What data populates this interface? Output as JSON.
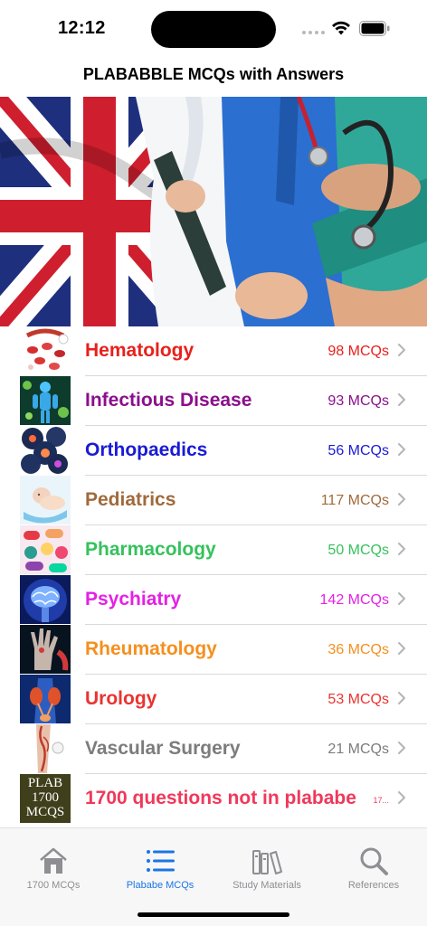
{
  "status_bar": {
    "time": "12:12"
  },
  "nav": {
    "title": "PLABABBLE MCQs with Answers"
  },
  "hero": {
    "icon": "union-jack-doctors-banner"
  },
  "categories": [
    {
      "name": "Hematology",
      "count": "98 MCQs",
      "color": "#e8201c",
      "icon": "blood-cells-thumbnail"
    },
    {
      "name": "Infectious Disease",
      "count": "93 MCQs",
      "color": "#8a0f8c",
      "icon": "virus-body-thumbnail"
    },
    {
      "name": "Orthopaedics",
      "count": "56 MCQs",
      "color": "#1a1ad6",
      "icon": "joints-thumbnail"
    },
    {
      "name": "Pediatrics",
      "count": "117 MCQs",
      "color": "#a06a3c",
      "icon": "baby-thumbnail"
    },
    {
      "name": "Pharmacology",
      "count": "50 MCQs",
      "color": "#35c25c",
      "icon": "pills-thumbnail"
    },
    {
      "name": "Psychiatry",
      "count": "142 MCQs",
      "color": "#e520e5",
      "icon": "brain-thumbnail"
    },
    {
      "name": "Rheumatology",
      "count": "36 MCQs",
      "color": "#f58f1e",
      "icon": "hand-xray-thumbnail"
    },
    {
      "name": "Urology",
      "count": "53 MCQs",
      "color": "#ea3330",
      "icon": "kidney-thumbnail"
    },
    {
      "name": "Vascular Surgery",
      "count": "21 MCQs",
      "color": "#7c7c7c",
      "icon": "leg-veins-thumbnail"
    },
    {
      "name": "1700 questions not in plababe",
      "count": "17...",
      "color": "#f0385a",
      "icon": "plab-1700-thumbnail",
      "thumb_text": [
        "PLAB",
        "1700",
        "MCQS"
      ]
    }
  ],
  "tabs": [
    {
      "label": "1700 MCQs",
      "icon": "home-icon",
      "active": false
    },
    {
      "label": "Plababe MCQs",
      "icon": "list-icon",
      "active": true
    },
    {
      "label": "Study Materials",
      "icon": "books-icon",
      "active": false
    },
    {
      "label": "References",
      "icon": "search-icon",
      "active": false
    }
  ],
  "colors": {
    "tab_active": "#1a76e6",
    "tab_inactive": "#8e8e93"
  }
}
